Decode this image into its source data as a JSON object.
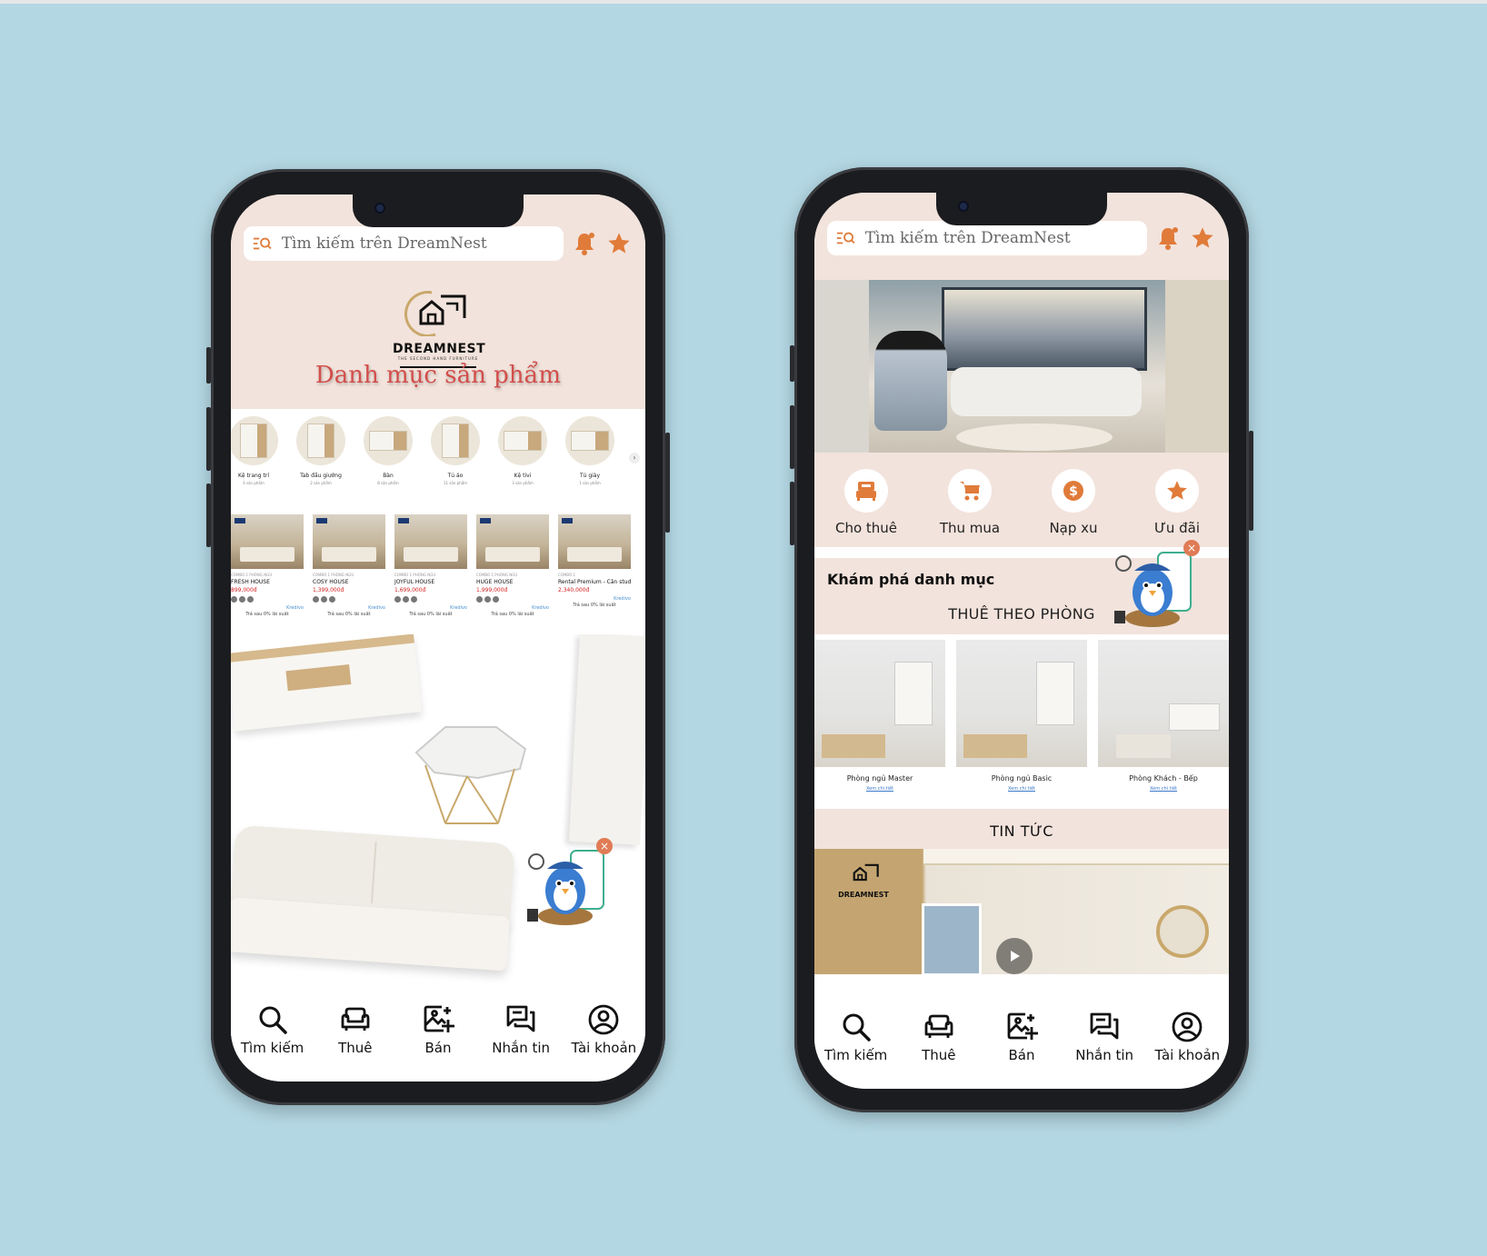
{
  "colors": {
    "background": "#b3d7e3",
    "header_peach": "#f2e3dc",
    "accent_orange": "#e07b3a",
    "title_red": "#d24e4b"
  },
  "search": {
    "placeholder": "Tìm kiếm trên DreamNest"
  },
  "brand": {
    "name": "DREAMNEST",
    "tagline": "THE SECOND HAND FURNITURE"
  },
  "nav": {
    "items": [
      {
        "label": "Tìm kiếm",
        "icon": "search-icon"
      },
      {
        "label": "Thuê",
        "icon": "armchair-icon"
      },
      {
        "label": "Bán",
        "icon": "image-plus-icon"
      },
      {
        "label": "Nhắn tin",
        "icon": "chat-icon"
      },
      {
        "label": "Tài khoản",
        "icon": "account-icon"
      }
    ]
  },
  "left": {
    "title": "Danh mục sản phẩm",
    "categories": [
      {
        "label": "Kệ trang trí",
        "sub": "4 sản phẩm"
      },
      {
        "label": "Tab đầu giường",
        "sub": "2 sản phẩm"
      },
      {
        "label": "Bàn",
        "sub": "8 sản phẩm"
      },
      {
        "label": "Tủ áo",
        "sub": "11 sản phẩm"
      },
      {
        "label": "Kệ tivi",
        "sub": "3 sản phẩm"
      },
      {
        "label": "Tủ giày",
        "sub": "1 sản phẩm"
      }
    ],
    "products": [
      {
        "meta": "COMBO 1 PHÒNG NGỦ",
        "name": "FRESH HOUSE",
        "price": "899,000đ",
        "pay": "Trả sau 0% lãi suất"
      },
      {
        "meta": "COMBO 1 PHÒNG NGỦ",
        "name": "COSY HOUSE",
        "price": "1,399,000đ",
        "pay": "Trả sau 0% lãi suất"
      },
      {
        "meta": "COMBO 1 PHÒNG NGỦ",
        "name": "JOYFUL HOUSE",
        "price": "1,699,000đ",
        "pay": "Trả sau 0% lãi suất"
      },
      {
        "meta": "COMBO 1 PHÒNG NGỦ",
        "name": "HUGE HOUSE",
        "price": "1,999,000đ",
        "pay": "Trả sau 0% lãi suất"
      },
      {
        "meta": "COMBO 1",
        "name": "Rental Premium - Căn studio",
        "price": "2,340,000đ",
        "pay": "Trả sau 0% lãi suất"
      }
    ],
    "kredivo": "Kredivo"
  },
  "right": {
    "quick_actions": [
      {
        "label": "Cho thuê",
        "icon": "bed-icon"
      },
      {
        "label": "Thu mua",
        "icon": "cart-icon"
      },
      {
        "label": "Nạp xu",
        "icon": "coin-icon"
      },
      {
        "label": "Ưu đãi",
        "icon": "star-icon"
      }
    ],
    "explore_title": "Khám phá danh mục",
    "explore_sub": "THUÊ THEO PHÒNG",
    "rooms": [
      {
        "name": "Phòng ngủ Master",
        "link": "Xem chi tiết"
      },
      {
        "name": "Phòng ngủ Basic",
        "link": "Xem chi tiết"
      },
      {
        "name": "Phòng Khách - Bếp",
        "link": "Xem chi tiết"
      }
    ],
    "news_title": "TIN TỨC"
  }
}
